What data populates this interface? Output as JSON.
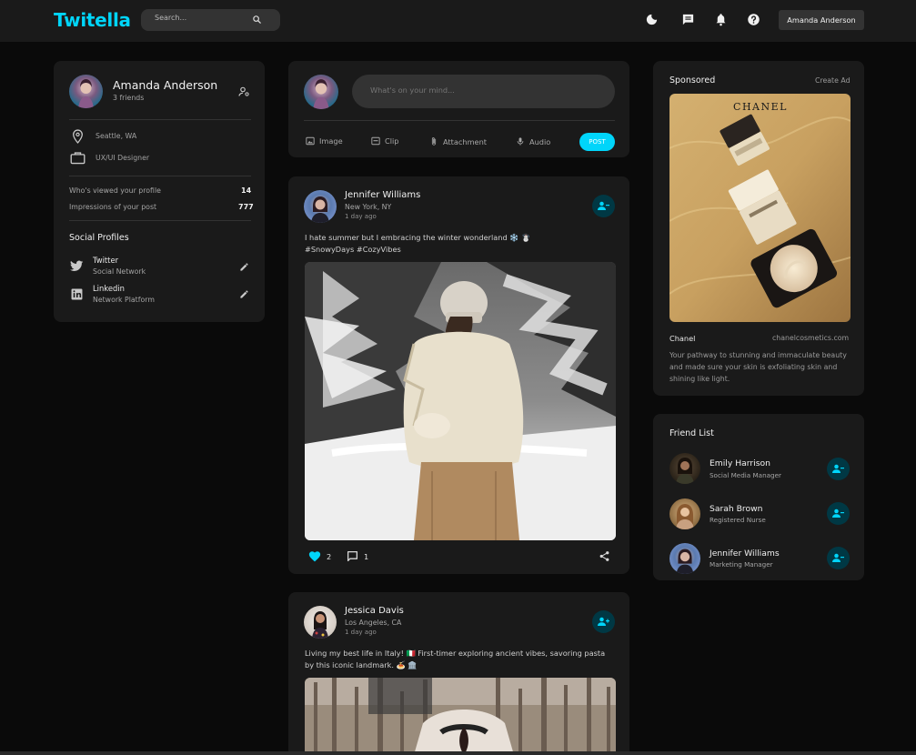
{
  "navbar": {
    "logo": "Twitella",
    "search_placeholder": "Search...",
    "user_name": "Amanda Anderson",
    "icons": [
      "moon-icon",
      "message-icon",
      "bell-icon",
      "help-icon"
    ]
  },
  "profile": {
    "name": "Amanda Anderson",
    "friends": "3 friends",
    "location": "Seattle, WA",
    "occupation": "UX/UI Designer",
    "viewed_label": "Who's viewed your profile",
    "viewed_value": "14",
    "impressions_label": "Impressions of your post",
    "impressions_value": "777",
    "social_title": "Social Profiles",
    "socials": [
      {
        "name": "Twitter",
        "type": "Social Network"
      },
      {
        "name": "Linkedin",
        "type": "Network Platform"
      }
    ]
  },
  "composer": {
    "placeholder": "What's on your mind...",
    "actions": [
      "Image",
      "Clip",
      "Attachment",
      "Audio"
    ],
    "post_label": "POST"
  },
  "posts": [
    {
      "author": "Jennifer Williams",
      "location": "New York, NY",
      "time": "1 day ago",
      "text": "I hate summer but I embracing the winter wonderland ❄️ ☃️ #SnowyDays #CozyVibes",
      "likes": "2",
      "comments": "1"
    },
    {
      "author": "Jessica Davis",
      "location": "Los Angeles, CA",
      "time": "1 day ago",
      "text": "Living my best life in Italy! 🇮🇹 First-timer exploring ancient vibes, savoring pasta by this iconic landmark. 🍝 🏛️"
    }
  ],
  "sponsored": {
    "title": "Sponsored",
    "create_ad": "Create Ad",
    "ad_brand_logo": "CHANEL",
    "brand": "Chanel",
    "site": "chanelcosmetics.com",
    "description": "Your pathway to stunning and immaculate beauty and made sure your skin is exfoliating skin and shining like light."
  },
  "friend_list": {
    "title": "Friend List",
    "friends": [
      {
        "name": "Emily Harrison",
        "role": "Social Media Manager"
      },
      {
        "name": "Sarah Brown",
        "role": "Registered Nurse"
      },
      {
        "name": "Jennifer Williams",
        "role": "Marketing Manager"
      }
    ]
  },
  "colors": {
    "accent": "#00d5fa",
    "card": "#1a1a1a",
    "background": "#0a0a0a"
  }
}
